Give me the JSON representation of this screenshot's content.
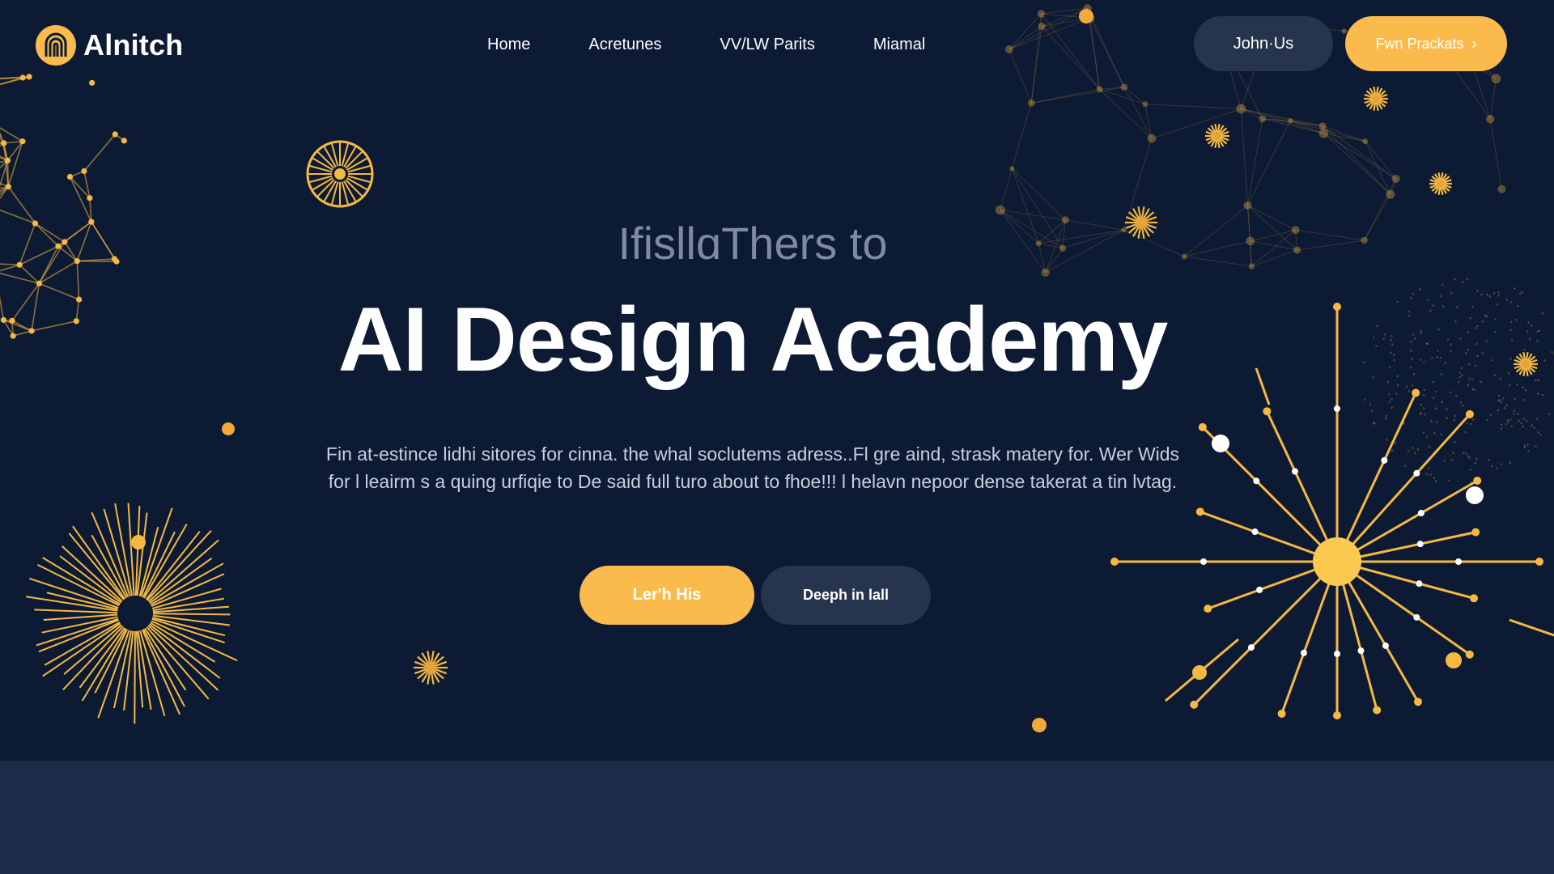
{
  "brand": {
    "name": "Alnitch",
    "logo_icon": "brain-arch-icon",
    "accent": "#fbbb4c"
  },
  "nav": {
    "items": [
      {
        "label": "Home"
      },
      {
        "label": "Acretunes"
      },
      {
        "label": "VV/LW Parits"
      },
      {
        "label": "Miamal"
      }
    ]
  },
  "header_actions": {
    "join_label": "John·Us",
    "primary_label": "Fwn Prackats",
    "primary_icon": "chevron-right-icon"
  },
  "hero": {
    "eyebrow": "IfisllɑThers to",
    "headline": "AI Design Academy",
    "description": "Fin at-estince lidhi sitores for cinna. the whal soclutems adress..Fl gre aind, strask matery for. Wer Wids for l leairm s a quing urfiqie to De said full turo about to fhoe!!! l helavn nepoor dense takerat a tin lvtag.",
    "cta_primary": "Ler'h His",
    "cta_secondary": "Deeph in lall"
  },
  "colors": {
    "background": "#0d1a34",
    "lower_band": "#1c2b48",
    "secondary_button": "#26344d"
  }
}
